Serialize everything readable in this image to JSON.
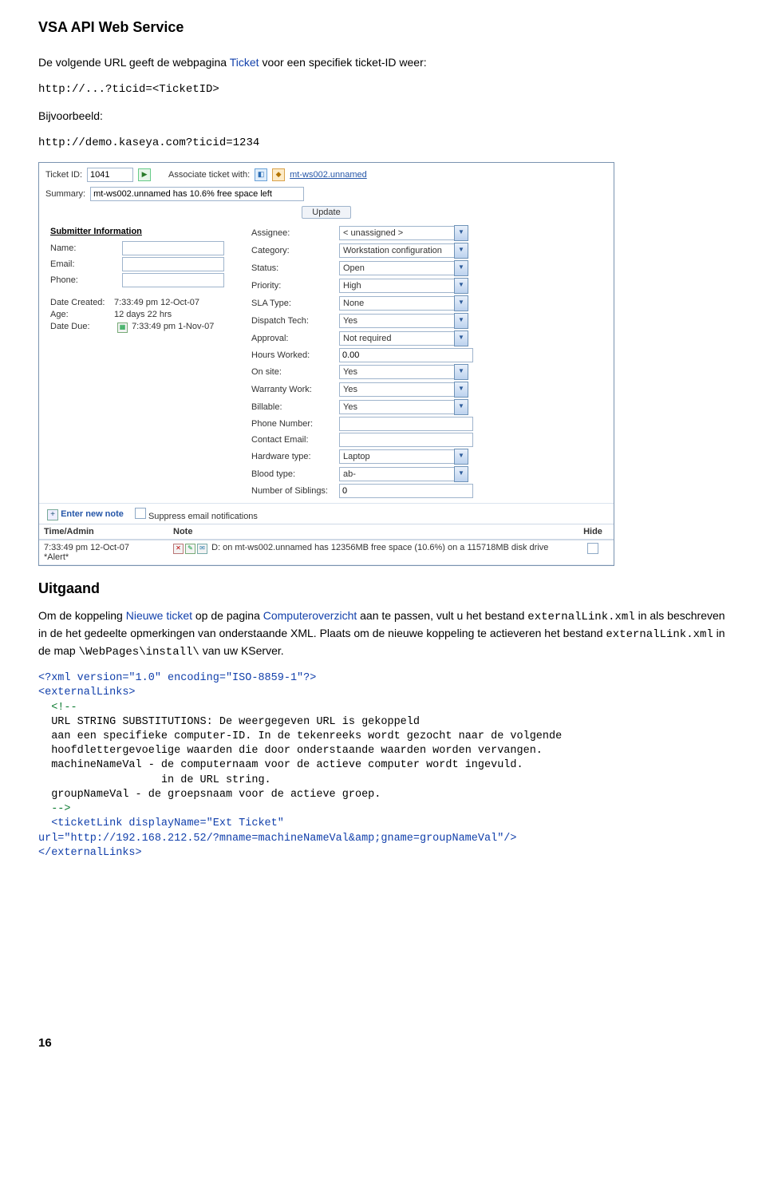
{
  "doc": {
    "header": "VSA API Web Service",
    "p1_a": "De volgende URL geeft de webpagina ",
    "p1_link": "Ticket",
    "p1_b": " voor een specifiek ticket-ID weer:",
    "url1": "http://...?ticid=<TicketID>",
    "bijv": "Bijvoorbeeld:",
    "url2": "http://demo.kaseya.com?ticid=1234",
    "h2": "Uitgaand",
    "p2_a": "Om de koppeling ",
    "p2_link1": "Nieuwe ticket",
    "p2_b": " op de pagina ",
    "p2_link2": "Computeroverzicht",
    "p2_c": " aan te passen, vult u het bestand ",
    "p2_code1": "externalLink.xml",
    "p2_d": " in als beschreven in de het gedeelte opmerkingen van onderstaande XML. Plaats om de nieuwe koppeling te actieveren het bestand ",
    "p2_code2": "externalLink.xml",
    "p2_e": " in de map  ",
    "p2_code3": "\\WebPages\\install\\",
    "p2_f": " van uw KServer.",
    "code": {
      "l1": "<?xml version=\"1.0\" encoding=\"ISO-8859-1\"?>",
      "l2": "<externalLinks>",
      "l3": "  <!--",
      "l4": "  URL STRING SUBSTITUTIONS: De weergegeven URL is gekoppeld",
      "l5": "  aan een specifieke computer-ID. In de tekenreeks wordt gezocht naar de volgende",
      "l6": "  hoofdlettergevoelige waarden die door onderstaande waarden worden vervangen.",
      "l7": "  machineNameVal - de computernaam voor de actieve computer wordt ingevuld.",
      "l8": "                   in de URL string.",
      "l9": "  groupNameVal - de groepsnaam voor de actieve groep.",
      "l10": "  -->",
      "l11a": "  <ticketLink displayName=\"Ext Ticket\"",
      "l11b": "url=\"http://192.168.212.52/?mname=machineNameVal&amp;gname=groupNameVal\"/>",
      "l12": "</externalLinks>"
    },
    "pagenum": "16"
  },
  "form": {
    "ticket_id_lbl": "Ticket ID:",
    "ticket_id_val": "1041",
    "assoc_lbl": "Associate ticket with:",
    "assoc_val": "mt-ws002.unnamed",
    "summary_lbl": "Summary:",
    "summary_val": "mt-ws002.unnamed has 10.6% free space left",
    "update_btn": "Update",
    "submitter_head": "Submitter Information",
    "name_lbl": "Name:",
    "email_lbl": "Email:",
    "phone_lbl": "Phone:",
    "date_created_lbl": "Date Created:",
    "date_created_val": "7:33:49 pm 12-Oct-07",
    "age_lbl": "Age:",
    "age_val": "12 days 22 hrs",
    "date_due_lbl": "Date Due:",
    "date_due_val": "7:33:49 pm 1-Nov-07",
    "right": {
      "Assignee": "< unassigned >",
      "Category": "Workstation configuration",
      "Status": "Open",
      "Priority": "High",
      "SLA Type": "None",
      "Dispatch Tech": "Yes",
      "Approval": "Not required",
      "Hours Worked": "0.00",
      "On site": "Yes",
      "Warranty Work": "Yes",
      "Billable": "Yes",
      "Phone Number": "",
      "Contact Email": "",
      "Hardware type": "Laptop",
      "Blood type": "ab-",
      "Number of Siblings": "0"
    },
    "enter_note": "Enter new note",
    "suppress": "Suppress email notifications",
    "table": {
      "h1": "Time/Admin",
      "h2": "Note",
      "h3": "Hide",
      "r1c1a": "7:33:49 pm 12-Oct-07",
      "r1c1b": "*Alert*",
      "r1c2": "D: on mt-ws002.unnamed has 12356MB free space (10.6%) on a 115718MB disk drive"
    }
  }
}
